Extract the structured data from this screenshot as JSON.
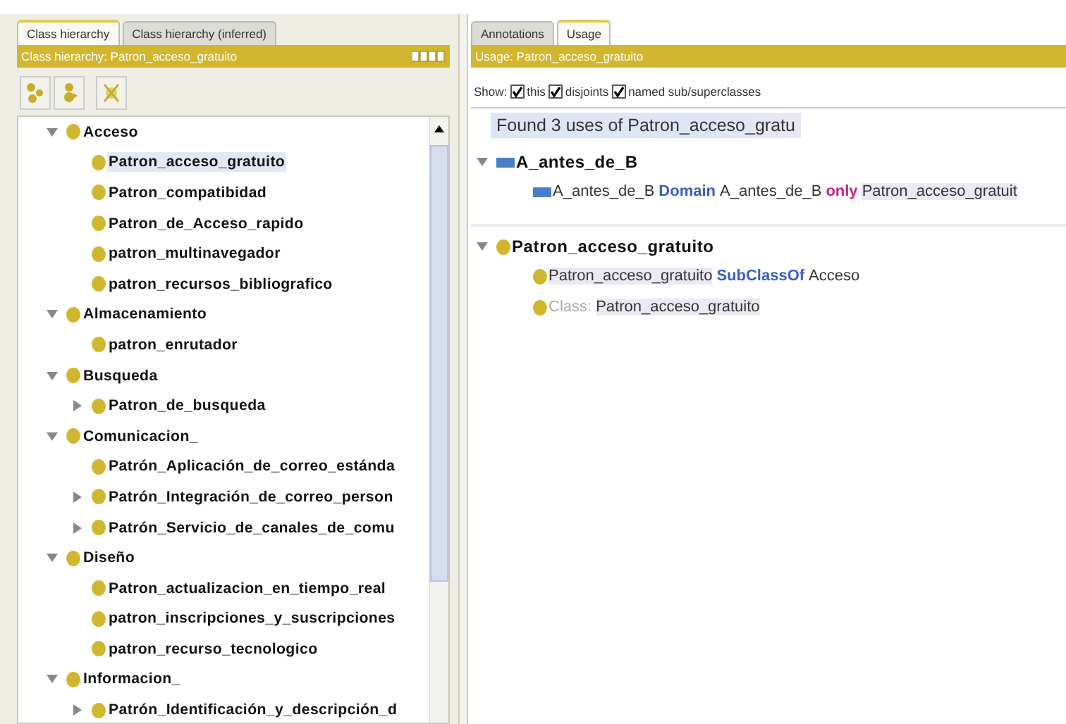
{
  "left": {
    "tabs": [
      {
        "label": "Class hierarchy",
        "selected": true
      },
      {
        "label": "Class hierarchy (inferred)",
        "selected": false
      }
    ],
    "header": "Class hierarchy: Patron_acceso_gratuito",
    "tree": [
      {
        "label": "Acceso",
        "selected": false,
        "expanded": true,
        "children": [
          {
            "label": "Patron_acceso_gratuito",
            "selected": true
          },
          {
            "label": "Patron_compatibidad",
            "selected": false
          },
          {
            "label": "Patron_de_Acceso_rapido",
            "selected": false
          },
          {
            "label": "patron_multinavegador",
            "selected": false
          },
          {
            "label": "patron_recursos_bibliografico",
            "selected": false
          }
        ]
      },
      {
        "label": "Almacenamiento",
        "selected": false,
        "expanded": true,
        "children": [
          {
            "label": "patron_enrutador",
            "selected": false
          }
        ]
      },
      {
        "label": "Busqueda",
        "selected": false,
        "expanded": true,
        "children": [
          {
            "label": "Patron_de_busqueda",
            "selected": false,
            "expanded": false
          }
        ]
      },
      {
        "label": "Comunicacion_",
        "selected": false,
        "expanded": true,
        "children": [
          {
            "label": "Patrón_Aplicación_de_correo_estánda",
            "selected": false
          },
          {
            "label": "Patrón_Integración_de_correo_person",
            "selected": false,
            "expanded": false
          },
          {
            "label": "Patrón_Servicio_de_canales_de_comu",
            "selected": false,
            "expanded": false
          }
        ]
      },
      {
        "label": "Diseño",
        "selected": false,
        "expanded": true,
        "children": [
          {
            "label": "Patron_actualizacion_en_tiempo_real",
            "selected": false
          },
          {
            "label": "patron_inscripciones_y_suscripciones",
            "selected": false
          },
          {
            "label": "patron_recurso_tecnologico",
            "selected": false
          }
        ]
      },
      {
        "label": "Informacion_",
        "selected": false,
        "expanded": true,
        "children": [
          {
            "label": "Patrón_Identificación_y_descripción_d",
            "selected": false,
            "expanded": false
          }
        ]
      }
    ]
  },
  "right": {
    "tabs": [
      {
        "label": "Annotations",
        "selected": false
      },
      {
        "label": "Usage",
        "selected": true
      }
    ],
    "header": "Usage: Patron_acceso_gratuito",
    "show_label": "Show:",
    "show_options": [
      {
        "label": "this",
        "checked": true
      },
      {
        "label": "disjoints",
        "checked": true
      },
      {
        "label": "named sub/superclasses",
        "checked": true
      }
    ],
    "found": "Found 3 uses of Patron_acceso_gratu",
    "groups": [
      {
        "kind": "property",
        "label": "A_antes_de_B",
        "expanded": true,
        "items": [
          {
            "kind": "property",
            "parts": [
              {
                "kind": "plain",
                "text": "A_antes_de_B"
              },
              {
                "kind": "keyword",
                "text": "Domain"
              },
              {
                "kind": "plain",
                "text": "A_antes_de_B"
              },
              {
                "kind": "restriction",
                "text": "only"
              },
              {
                "kind": "highlight",
                "text": "Patron_acceso_gratuit"
              }
            ]
          }
        ]
      },
      {
        "kind": "class",
        "label": "Patron_acceso_gratuito",
        "expanded": true,
        "items": [
          {
            "kind": "class",
            "parts": [
              {
                "kind": "highlight",
                "text": "Patron_acceso_gratuito"
              },
              {
                "kind": "keyword",
                "text": "SubClassOf"
              },
              {
                "kind": "plain",
                "text": "Acceso"
              }
            ]
          },
          {
            "kind": "class",
            "parts": [
              {
                "kind": "muted",
                "text": "Class:"
              },
              {
                "kind": "highlight",
                "text": "Patron_acceso_gratuito"
              }
            ]
          }
        ]
      }
    ]
  }
}
